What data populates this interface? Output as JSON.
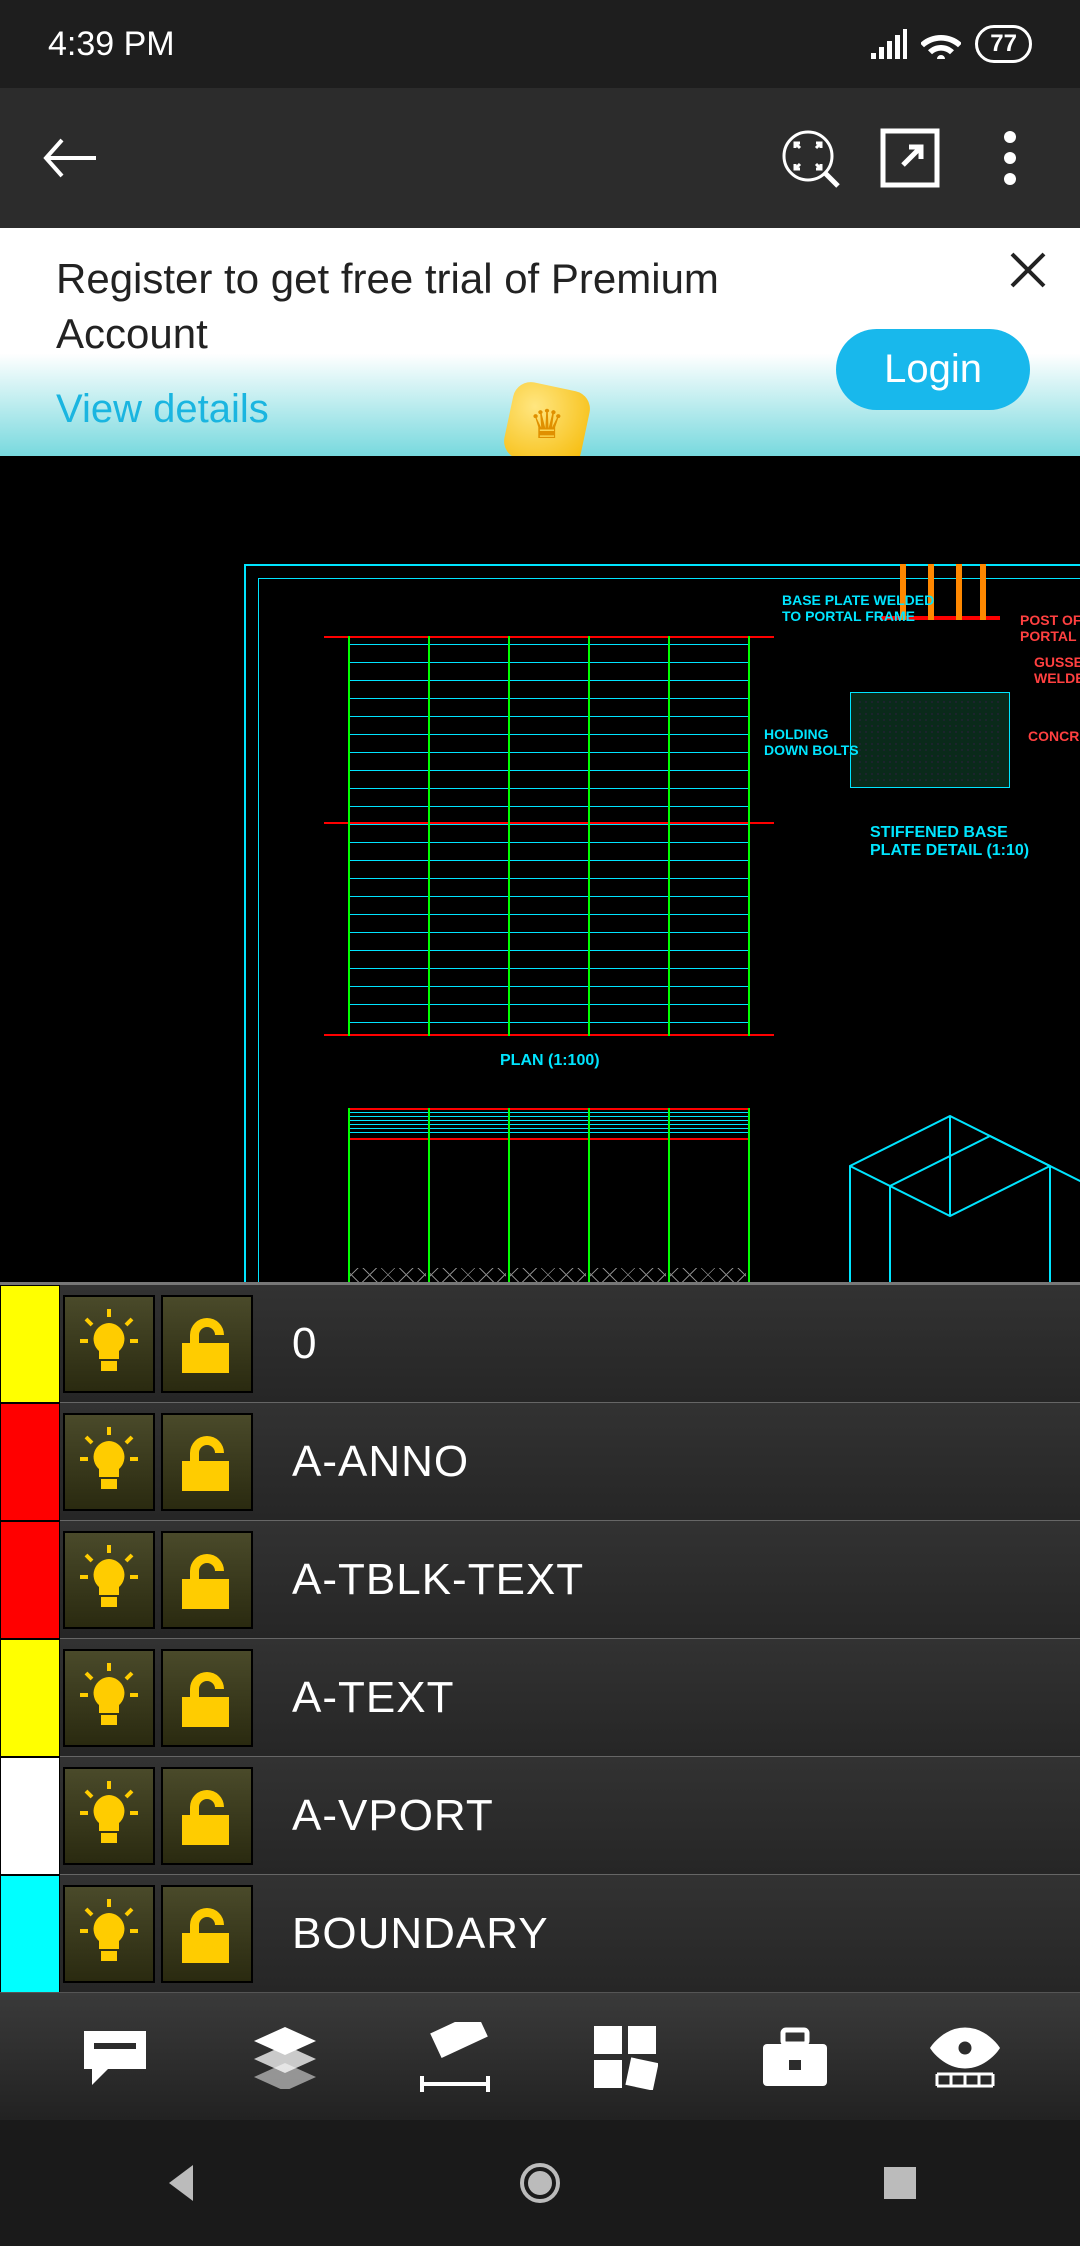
{
  "status": {
    "time": "4:39 PM",
    "battery": "77"
  },
  "banner": {
    "title": "Register to get free trial of Premium Account",
    "details_link": "View details",
    "login_label": "Login"
  },
  "drawing": {
    "plan_label": "PLAN (1:100)",
    "detail_title": "STIFFENED BASE",
    "detail_sub": "PLATE DETAIL (1:10)",
    "note_baseplate_l1": "BASE PLATE WELDED",
    "note_baseplate_l2": "TO PORTAL FRAME",
    "note_holding_l1": "HOLDING",
    "note_holding_l2": "DOWN BOLTS",
    "note_post_l1": "POST OF S",
    "note_post_l2": "PORTAL FR",
    "note_gusset_l1": "GUSSE",
    "note_gusset_l2": "WELDE",
    "note_concrete": "CONCRE"
  },
  "layers": [
    {
      "color": "#ffff00",
      "name": "0"
    },
    {
      "color": "#ff0000",
      "name": "A-ANNO"
    },
    {
      "color": "#ff0000",
      "name": "A-TBLK-TEXT"
    },
    {
      "color": "#ffff00",
      "name": "A-TEXT"
    },
    {
      "color": "#ffffff",
      "name": "A-VPORT"
    },
    {
      "color": "#00ffff",
      "name": "BOUNDARY"
    }
  ],
  "tools": {
    "comment": "comment",
    "layers": "layers",
    "measure": "measure",
    "blocks": "blocks",
    "toolbox": "toolbox",
    "visual": "visual"
  }
}
